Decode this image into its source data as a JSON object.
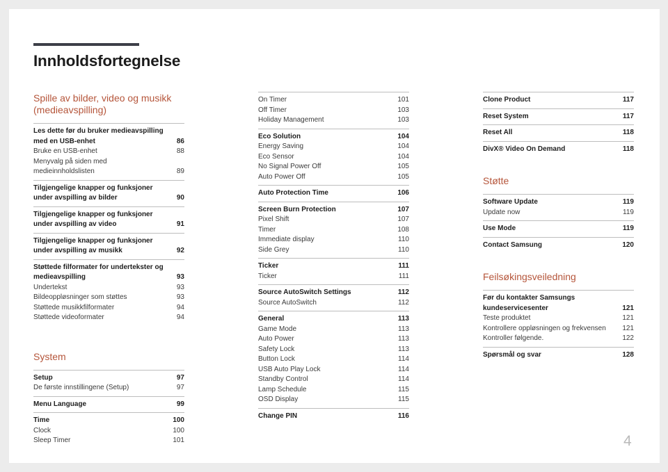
{
  "page": {
    "title": "Innholdsfortegnelse",
    "page_number": "4",
    "accent_color": "#b5553a",
    "title_bar_color": "#3d3f48"
  },
  "columns": [
    {
      "sections": [
        {
          "heading": "Spille av bilder, video og musikk (medieavspilling)",
          "groups": [
            {
              "items": [
                {
                  "label": "Les dette før du bruker medieavspilling med en USB-enhet",
                  "page": "86",
                  "bold": true
                },
                {
                  "label": "Bruke en USB-enhet",
                  "page": "88",
                  "bold": false
                },
                {
                  "label": "Menyvalg på siden med medieinnholdslisten",
                  "page": "89",
                  "bold": false
                }
              ]
            },
            {
              "items": [
                {
                  "label": "Tilgjengelige knapper og funksjoner under avspilling av bilder",
                  "page": "90",
                  "bold": true
                }
              ]
            },
            {
              "items": [
                {
                  "label": "Tilgjengelige knapper og funksjoner under avspilling av video",
                  "page": "91",
                  "bold": true
                }
              ]
            },
            {
              "items": [
                {
                  "label": "Tilgjengelige knapper og funksjoner under avspilling av musikk",
                  "page": "92",
                  "bold": true
                }
              ]
            },
            {
              "items": [
                {
                  "label": "Støttede filformater for undertekster og medieavspilling",
                  "page": "93",
                  "bold": true
                },
                {
                  "label": "Undertekst",
                  "page": "93",
                  "bold": false
                },
                {
                  "label": "Bildeoppløsninger som støttes",
                  "page": "93",
                  "bold": false
                },
                {
                  "label": "Støttede musikkfilformater",
                  "page": "94",
                  "bold": false
                },
                {
                  "label": "Støttede videoformater",
                  "page": "94",
                  "bold": false
                }
              ]
            }
          ]
        },
        {
          "heading": "System",
          "groups": [
            {
              "items": [
                {
                  "label": "Setup",
                  "page": "97",
                  "bold": true
                },
                {
                  "label": "De første innstillingene (Setup)",
                  "page": "97",
                  "bold": false
                }
              ]
            },
            {
              "items": [
                {
                  "label": "Menu Language",
                  "page": "99",
                  "bold": true
                }
              ]
            },
            {
              "items": [
                {
                  "label": "Time",
                  "page": "100",
                  "bold": true
                },
                {
                  "label": "Clock",
                  "page": "100",
                  "bold": false
                },
                {
                  "label": "Sleep Timer",
                  "page": "101",
                  "bold": false
                }
              ]
            }
          ]
        }
      ]
    },
    {
      "sections": [
        {
          "heading": "",
          "groups": [
            {
              "items": [
                {
                  "label": "On Timer",
                  "page": "101",
                  "bold": false
                },
                {
                  "label": "Off Timer",
                  "page": "103",
                  "bold": false
                },
                {
                  "label": "Holiday Management",
                  "page": "103",
                  "bold": false
                }
              ]
            },
            {
              "items": [
                {
                  "label": "Eco Solution",
                  "page": "104",
                  "bold": true
                },
                {
                  "label": "Energy Saving",
                  "page": "104",
                  "bold": false
                },
                {
                  "label": "Eco Sensor",
                  "page": "104",
                  "bold": false
                },
                {
                  "label": "No Signal Power Off",
                  "page": "105",
                  "bold": false
                },
                {
                  "label": "Auto Power Off",
                  "page": "105",
                  "bold": false
                }
              ]
            },
            {
              "items": [
                {
                  "label": "Auto Protection Time",
                  "page": "106",
                  "bold": true
                }
              ]
            },
            {
              "items": [
                {
                  "label": "Screen Burn Protection",
                  "page": "107",
                  "bold": true
                },
                {
                  "label": "Pixel Shift",
                  "page": "107",
                  "bold": false
                },
                {
                  "label": "Timer",
                  "page": "108",
                  "bold": false
                },
                {
                  "label": "Immediate display",
                  "page": "110",
                  "bold": false
                },
                {
                  "label": "Side Grey",
                  "page": "110",
                  "bold": false
                }
              ]
            },
            {
              "items": [
                {
                  "label": "Ticker",
                  "page": "111",
                  "bold": true
                },
                {
                  "label": "Ticker",
                  "page": "111",
                  "bold": false
                }
              ]
            },
            {
              "items": [
                {
                  "label": "Source AutoSwitch Settings",
                  "page": "112",
                  "bold": true
                },
                {
                  "label": "Source AutoSwitch",
                  "page": "112",
                  "bold": false
                }
              ]
            },
            {
              "items": [
                {
                  "label": "General",
                  "page": "113",
                  "bold": true
                },
                {
                  "label": "Game Mode",
                  "page": "113",
                  "bold": false
                },
                {
                  "label": "Auto Power",
                  "page": "113",
                  "bold": false
                },
                {
                  "label": "Safety Lock",
                  "page": "113",
                  "bold": false
                },
                {
                  "label": "Button Lock",
                  "page": "114",
                  "bold": false
                },
                {
                  "label": "USB Auto Play Lock",
                  "page": "114",
                  "bold": false
                },
                {
                  "label": "Standby Control",
                  "page": "114",
                  "bold": false
                },
                {
                  "label": "Lamp Schedule",
                  "page": "115",
                  "bold": false
                },
                {
                  "label": "OSD Display",
                  "page": "115",
                  "bold": false
                }
              ]
            },
            {
              "items": [
                {
                  "label": "Change PIN",
                  "page": "116",
                  "bold": true
                }
              ]
            }
          ]
        }
      ]
    },
    {
      "sections": [
        {
          "heading": "",
          "groups": [
            {
              "items": [
                {
                  "label": "Clone Product",
                  "page": "117",
                  "bold": true
                }
              ]
            },
            {
              "items": [
                {
                  "label": "Reset System",
                  "page": "117",
                  "bold": true
                }
              ]
            },
            {
              "items": [
                {
                  "label": "Reset All",
                  "page": "118",
                  "bold": true
                }
              ]
            },
            {
              "items": [
                {
                  "label": "DivX® Video On Demand",
                  "page": "118",
                  "bold": true
                }
              ]
            }
          ]
        },
        {
          "heading": "Støtte",
          "groups": [
            {
              "items": [
                {
                  "label": "Software Update",
                  "page": "119",
                  "bold": true
                },
                {
                  "label": "Update now",
                  "page": "119",
                  "bold": false
                }
              ]
            },
            {
              "items": [
                {
                  "label": "Use Mode",
                  "page": "119",
                  "bold": true
                }
              ]
            },
            {
              "items": [
                {
                  "label": "Contact Samsung",
                  "page": "120",
                  "bold": true
                }
              ]
            }
          ]
        },
        {
          "heading": "Feilsøkingsveiledning",
          "groups": [
            {
              "items": [
                {
                  "label": "Før du kontakter Samsungs kundeservicesenter",
                  "page": "121",
                  "bold": true
                },
                {
                  "label": "Teste produktet",
                  "page": "121",
                  "bold": false
                },
                {
                  "label": "Kontrollere oppløsningen og frekvensen",
                  "page": "121",
                  "bold": false
                },
                {
                  "label": "Kontroller følgende.",
                  "page": "122",
                  "bold": false
                }
              ]
            },
            {
              "items": [
                {
                  "label": "Spørsmål og svar",
                  "page": "128",
                  "bold": true
                }
              ]
            }
          ]
        }
      ]
    }
  ]
}
